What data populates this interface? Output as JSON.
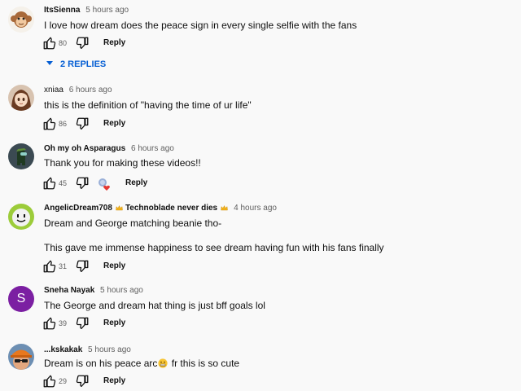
{
  "comments": [
    {
      "author": "ItsSienna",
      "time": "5 hours ago",
      "text": "I love how dream does the peace sign in every single selfie with the fans",
      "likes": "80",
      "reply_label": "Reply",
      "replies_toggle": "2 REPLIES"
    },
    {
      "author": "xniaa",
      "time": "6 hours ago",
      "text": "this is the definition of \"having the time of ur life\"",
      "likes": "86",
      "reply_label": "Reply"
    },
    {
      "author": "Oh my oh Asparagus",
      "time": "6 hours ago",
      "text": "Thank you for making these videos!!",
      "likes": "45",
      "reply_label": "Reply"
    },
    {
      "author": "AngelicDream708",
      "badge_text": "Technoblade never dies",
      "time": "4 hours ago",
      "text_line1": "Dream and George matching beanie tho-",
      "text_line2": "This gave me immense happiness to see dream having fun with his fans finally",
      "likes": "31",
      "reply_label": "Reply"
    },
    {
      "author": "Sneha Nayak",
      "avatar_letter": "S",
      "time": "5 hours ago",
      "text": "The George and dream hat thing is just bff goals lol",
      "likes": "39",
      "reply_label": "Reply"
    },
    {
      "author": "...kskakak",
      "time": "5 hours ago",
      "text_before": "Dream is on his peace arc",
      "text_after": " fr this is so cute",
      "likes": "29",
      "reply_label": "Reply"
    }
  ],
  "colors": {
    "accent_blue": "#065fd4",
    "sneha_avatar": "#7b1fa2",
    "heart": "#e53935"
  },
  "icons": [
    "thumb-up-icon",
    "thumb-down-icon",
    "creator-heart-icon",
    "crown-icon",
    "chevron-down-icon",
    "grimace-emoji-icon"
  ]
}
